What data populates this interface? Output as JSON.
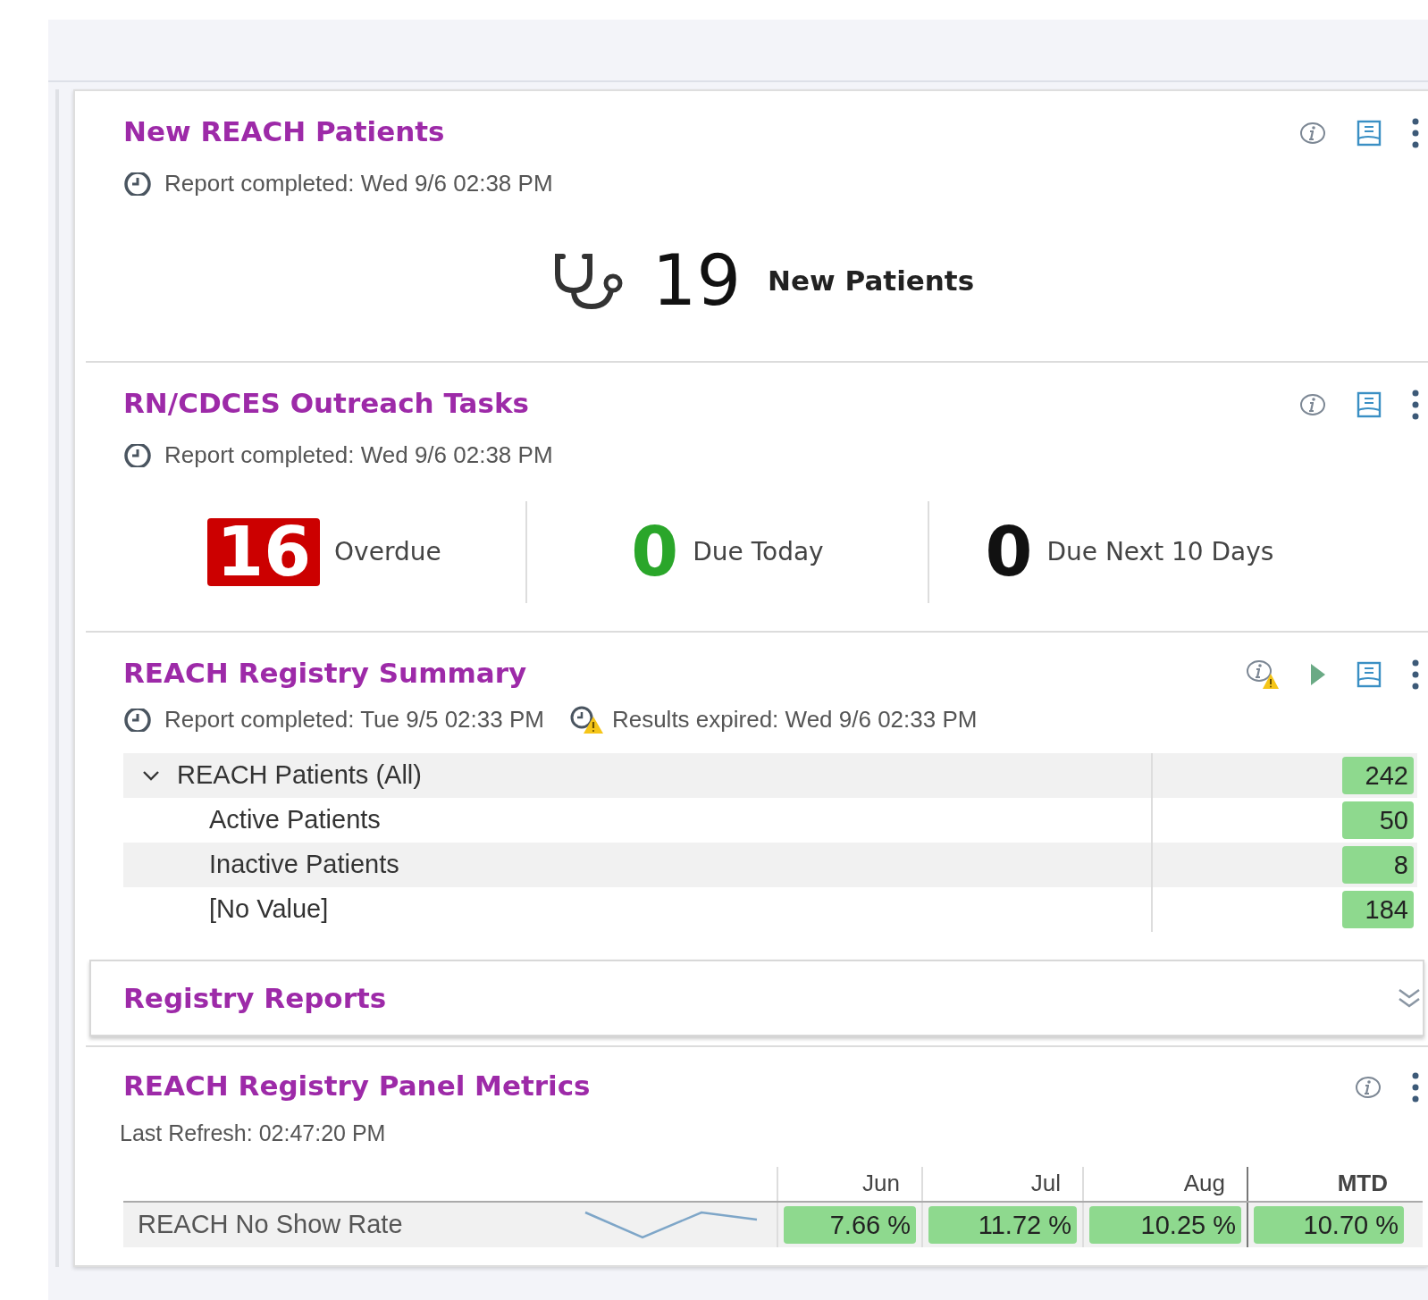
{
  "panels": [
    {
      "kind": "count",
      "title": "New REACH Patients",
      "report_time": "Report completed: Wed 9/6 02:38 PM",
      "count": "19",
      "count_label": "New Patients"
    },
    {
      "kind": "tasks",
      "title": "RN/CDCES Outreach Tasks",
      "report_time": "Report completed: Wed 9/6 02:38 PM",
      "stats": [
        {
          "value": "16",
          "label": "Overdue",
          "kind": "alert"
        },
        {
          "value": "0",
          "label": "Due Today",
          "kind": "good"
        },
        {
          "value": "0",
          "label": "Due Next 10 Days",
          "kind": "plain"
        }
      ]
    },
    {
      "kind": "tree",
      "title": "REACH Registry Summary",
      "report_time": "Report completed: Tue 9/5 02:33 PM",
      "expired_time": "Results expired: Wed 9/6 02:33 PM",
      "rows": [
        {
          "label": "REACH Patients (All)",
          "value": "242",
          "expanded": true,
          "children": [
            {
              "label": "Active Patients",
              "value": "50"
            },
            {
              "label": "Inactive Patients",
              "value": "8"
            },
            {
              "label": "[No Value]",
              "value": "184"
            }
          ]
        }
      ]
    },
    {
      "kind": "collapsed",
      "title": "Registry Reports",
      "expanded": false
    },
    {
      "kind": "metrics",
      "title": "REACH Registry Panel Metrics",
      "refresh": "Last Refresh: 02:47:20 PM",
      "columns": [
        "Jun",
        "Jul",
        "Aug",
        "MTD"
      ],
      "rows": [
        {
          "label": "REACH No Show Rate",
          "values": [
            "7.66 %",
            "11.72 %",
            "10.25 %",
            "10.70 %"
          ]
        }
      ]
    }
  ]
}
